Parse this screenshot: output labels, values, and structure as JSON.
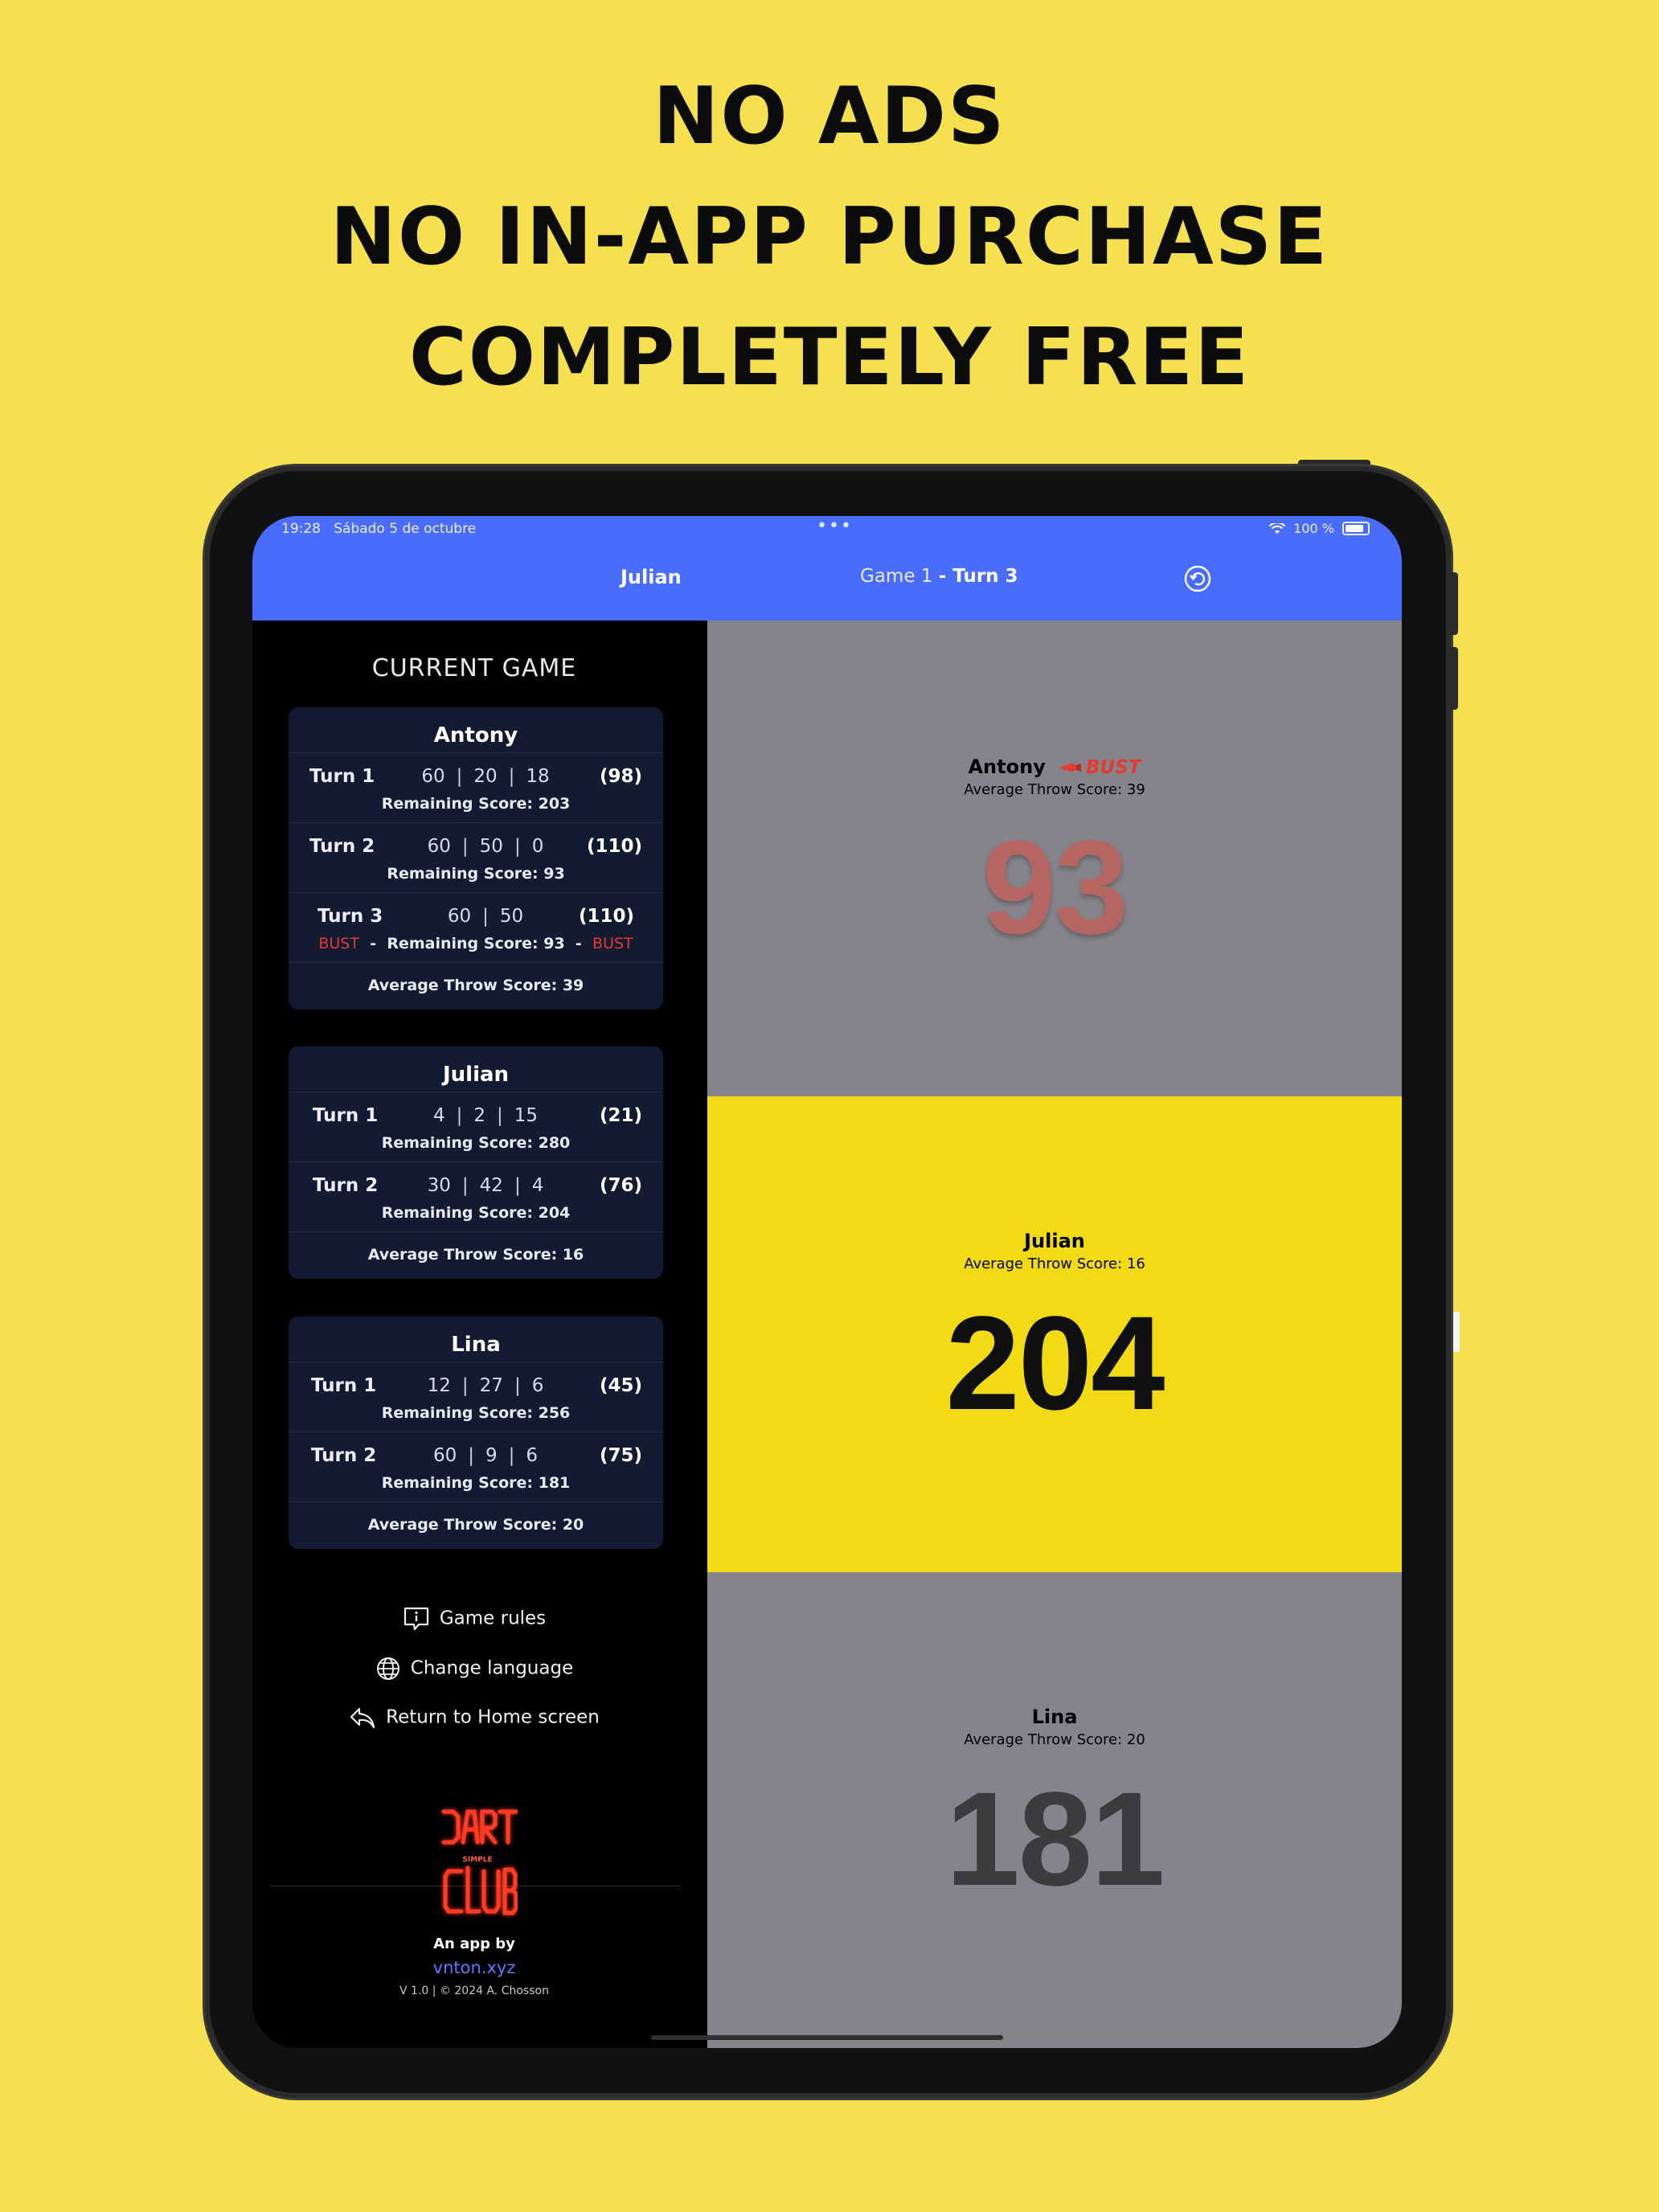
{
  "headline": [
    "NO ADS",
    "NO IN-APP PURCHASE",
    "COMPLETELY FREE"
  ],
  "status": {
    "time": "19:28",
    "date": "Sábado 5 de octubre",
    "dots": "•••",
    "battery": "100 %"
  },
  "nav": {
    "current_player": "Julian",
    "game": "Game 1",
    "turn": "- Turn 3"
  },
  "left": {
    "section_title": "CURRENT GAME",
    "players": [
      {
        "name": "Antony",
        "turns": [
          {
            "label": "Turn 1",
            "throws": [
              "60",
              "20",
              "18"
            ],
            "total": "(98)",
            "remaining": "Remaining Score: 203"
          },
          {
            "label": "Turn 2",
            "throws": [
              "60",
              "50",
              "0"
            ],
            "total": "(110)",
            "remaining": "Remaining Score: 93"
          },
          {
            "label": "Turn 3",
            "throws": [
              "60",
              "50"
            ],
            "total": "(110)",
            "remaining": "Remaining Score: 93",
            "bust": "BUST"
          }
        ],
        "average": "Average Throw Score: 39"
      },
      {
        "name": "Julian",
        "turns": [
          {
            "label": "Turn 1",
            "throws": [
              "4",
              "2",
              "15"
            ],
            "total": "(21)",
            "remaining": "Remaining Score: 280"
          },
          {
            "label": "Turn 2",
            "throws": [
              "30",
              "42",
              "4"
            ],
            "total": "(76)",
            "remaining": "Remaining Score: 204"
          }
        ],
        "average": "Average Throw Score: 16"
      },
      {
        "name": "Lina",
        "turns": [
          {
            "label": "Turn 1",
            "throws": [
              "12",
              "27",
              "6"
            ],
            "total": "(45)",
            "remaining": "Remaining Score: 256"
          },
          {
            "label": "Turn 2",
            "throws": [
              "60",
              "9",
              "6"
            ],
            "total": "(75)",
            "remaining": "Remaining Score: 181"
          }
        ],
        "average": "Average Throw Score: 20"
      }
    ],
    "menu": {
      "rules": "Game rules",
      "language": "Change language",
      "home": "Return to Home screen"
    },
    "footer": {
      "logo_text": "DART SIMPLE CLUB",
      "by": "An app by",
      "link": "vnton.xyz",
      "version": "V 1.0 | © 2024 A. Chosson"
    }
  },
  "right": {
    "players": [
      {
        "name": "Antony",
        "bust_label": "BUST",
        "avg": "Average Throw Score: 39",
        "score": "93",
        "bg": "#85848a",
        "fg": "#b56663"
      },
      {
        "name": "Julian",
        "avg": "Average Throw Score: 16",
        "score": "204",
        "bg": "#f2db14",
        "fg": "#101010"
      },
      {
        "name": "Lina",
        "avg": "Average Throw Score: 20",
        "score": "181",
        "bg": "#85848a",
        "fg": "#3c3c3e"
      }
    ]
  },
  "colors": {
    "background": "#f5e050",
    "header": "#4a6cfb",
    "card": "#131b33",
    "bust": "#e33b30",
    "link": "#5b78ff"
  }
}
